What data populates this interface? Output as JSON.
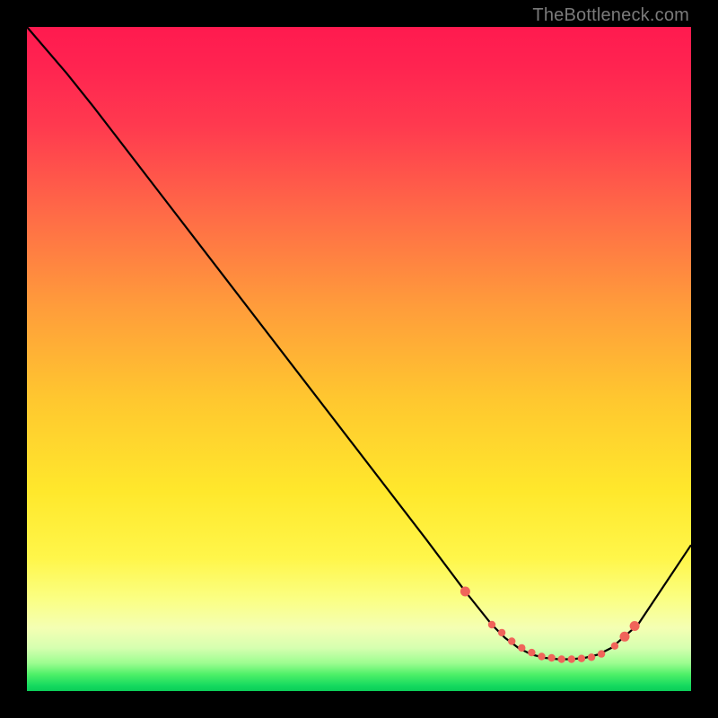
{
  "watermark": "TheBottleneck.com",
  "gradient_stops": [
    {
      "offset": 0.0,
      "color": "#ff144f"
    },
    {
      "offset": 0.0,
      "color": "#ff1a4f"
    },
    {
      "offset": 0.06,
      "color": "#ff2450"
    },
    {
      "offset": 0.15,
      "color": "#ff3a4f"
    },
    {
      "offset": 0.28,
      "color": "#ff6a47"
    },
    {
      "offset": 0.42,
      "color": "#ff9c3b"
    },
    {
      "offset": 0.56,
      "color": "#ffc72f"
    },
    {
      "offset": 0.7,
      "color": "#ffe82c"
    },
    {
      "offset": 0.8,
      "color": "#fff64a"
    },
    {
      "offset": 0.86,
      "color": "#fbff82"
    },
    {
      "offset": 0.905,
      "color": "#f4ffb3"
    },
    {
      "offset": 0.935,
      "color": "#d6ffb0"
    },
    {
      "offset": 0.958,
      "color": "#9cfd90"
    },
    {
      "offset": 0.975,
      "color": "#4ef068"
    },
    {
      "offset": 0.992,
      "color": "#15d95f"
    },
    {
      "offset": 1.0,
      "color": "#0bcc58"
    }
  ],
  "chart_data": {
    "type": "line",
    "title": "",
    "xlabel": "",
    "ylabel": "",
    "xlim": [
      0,
      100
    ],
    "ylim": [
      0,
      100
    ],
    "grid": false,
    "series": [
      {
        "name": "curve",
        "x": [
          0,
          6,
          10,
          20,
          30,
          40,
          50,
          60,
          66,
          70,
          72,
          74,
          76,
          78,
          80,
          82,
          84,
          86,
          88,
          92,
          100
        ],
        "y": [
          100,
          93,
          88,
          75,
          62,
          49,
          36,
          23,
          15,
          10,
          8,
          6.5,
          5.5,
          5,
          4.8,
          4.8,
          5,
          5.5,
          6.5,
          10,
          22
        ]
      }
    ],
    "markers": {
      "name": "highlight-dots",
      "color": "#f0645a",
      "x": [
        66,
        70,
        71.5,
        73,
        74.5,
        76,
        77.5,
        79,
        80.5,
        82,
        83.5,
        85,
        86.5,
        88.5,
        90,
        91.5
      ],
      "y": [
        15,
        10,
        8.8,
        7.5,
        6.5,
        5.8,
        5.2,
        5.0,
        4.8,
        4.8,
        4.9,
        5.1,
        5.6,
        6.8,
        8.2,
        9.8
      ]
    }
  }
}
